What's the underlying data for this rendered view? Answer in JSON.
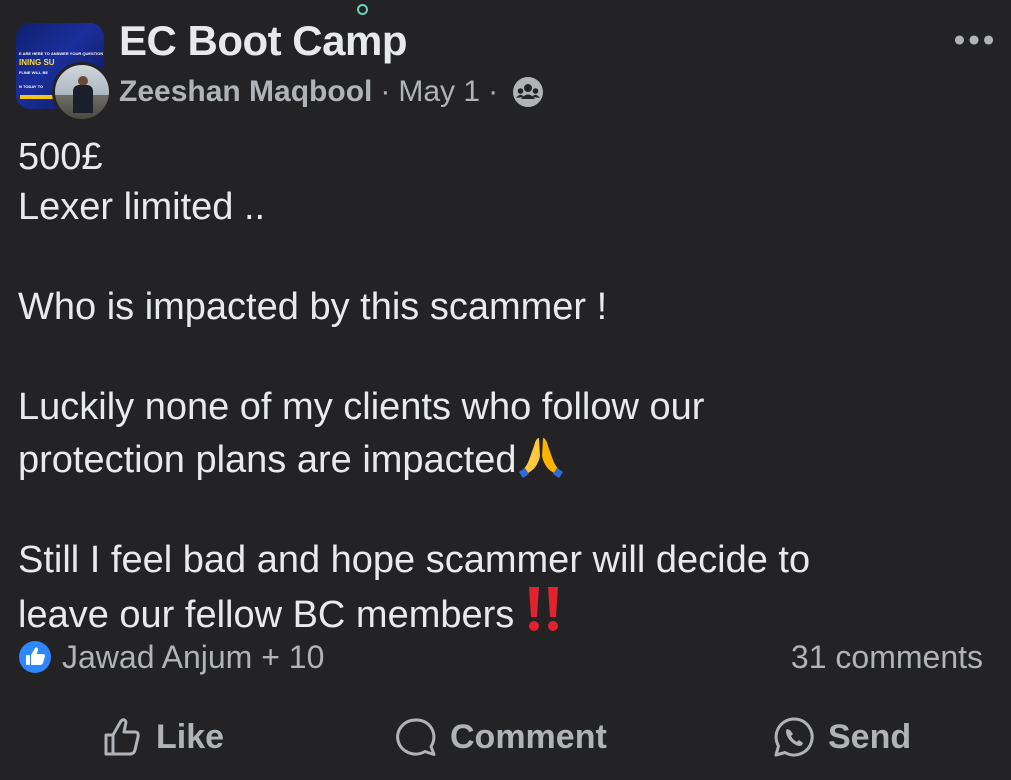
{
  "header": {
    "group_name": "EC Boot Camp",
    "author": "Zeeshan Maqbool",
    "separator": "·",
    "date": "May 1",
    "audience_icon": "group-audience-icon",
    "more_icon": "more-options-icon"
  },
  "group_thumbnail": {
    "line1": "E ARE HERE TO ANSWER YOUR QUESTION",
    "line2": "INING SU",
    "line3": "FLINE WILL BE",
    "line4": "N TODAY TO"
  },
  "post": {
    "lines": [
      "500£",
      "Lexer limited ..",
      "",
      "Who is impacted by this scammer !",
      "",
      "Luckily none of my clients who follow our",
      "protection plans are impacted",
      "",
      "Still I feel bad and hope scammer will decide to",
      "leave our fellow BC members"
    ],
    "emojis": [
      "folded-hands-emoji",
      "double-exclamation-emoji"
    ]
  },
  "reactions": {
    "summary": "Jawad Anjum + 10",
    "comments": "31 comments",
    "reaction_icon": "like-reaction-icon"
  },
  "actions": {
    "like_label": "Like",
    "comment_label": "Comment",
    "send_label": "Send"
  },
  "colors": {
    "background": "#232325",
    "text_primary": "#e9eaed",
    "text_secondary": "#b0b3b8",
    "like_blue": "#2d88ff"
  }
}
